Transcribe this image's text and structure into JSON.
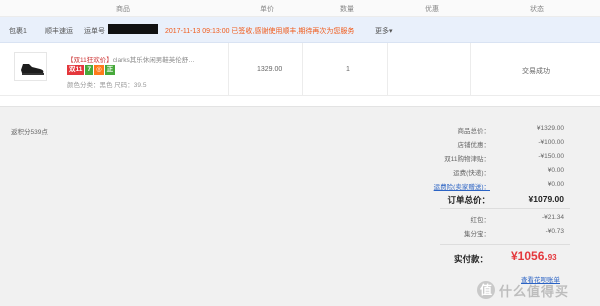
{
  "header": {
    "col_product": "商品",
    "col_price": "单价",
    "col_qty": "数量",
    "col_discount": "优惠",
    "col_status": "状态"
  },
  "package": {
    "name": "包裹1",
    "courier": "顺丰速运",
    "tracking_label": "运单号",
    "message": "2017-11-13 09:13:00   已签收,感谢使用顺丰,期待再次为您服务",
    "more": "更多▾"
  },
  "item": {
    "tag": "【双11狂欢价】",
    "title": "clarks其乐休闲男鞋英伦舒…",
    "badges": [
      "双11",
      "7",
      "◎",
      "正"
    ],
    "attrs": "颜色分类：黑色  尺码：39.5",
    "price": "1329.00",
    "qty": "1",
    "status": "交易成功"
  },
  "summary": {
    "points": "返积分539点",
    "rows": [
      {
        "label": "商品总价：",
        "value": "¥1329.00"
      },
      {
        "label": "店铺优惠：",
        "value": "-¥100.00"
      },
      {
        "label": "双11购物津贴：",
        "value": "-¥150.00"
      },
      {
        "label": "运费(快递)：",
        "value": "¥0.00"
      },
      {
        "label": "运费险(卖家赠送)：",
        "value": "¥0.00"
      },
      {
        "label": "订单总价：",
        "value": "¥1079.00"
      },
      {
        "label": "红包：",
        "value": "-¥21.34"
      },
      {
        "label": "集分宝：",
        "value": "-¥0.73"
      }
    ],
    "paid_label": "实付款：",
    "paid_main": "¥1056.",
    "paid_cents": "93",
    "log_link": "查看花呗账单"
  },
  "watermark": {
    "icon": "值",
    "text": "什么值得买"
  },
  "colors": {
    "accent_red": "#e4373c",
    "status_orange": "#f05a1a",
    "link_blue": "#2b63c4",
    "package_bg": "#e9f0fb"
  }
}
